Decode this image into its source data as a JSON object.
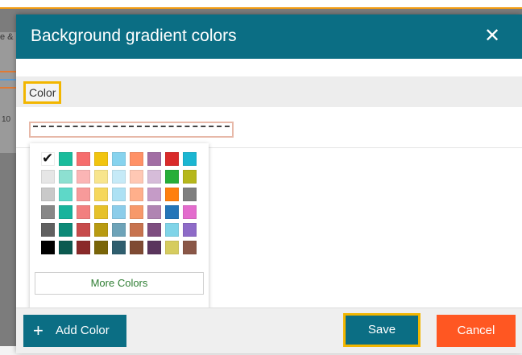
{
  "background": {
    "snippet_top": "e &",
    "snippet_bottom": "10"
  },
  "modal": {
    "title": "Background gradient colors",
    "close_icon": "close-icon",
    "section_label": "Color",
    "color_input_value": "",
    "palette": {
      "selected_color": "#ffffff",
      "rows": [
        [
          "#ffffff",
          "#1abc9c",
          "#f66d6d",
          "#f1c40f",
          "#87d3ee",
          "#ff9166",
          "#a26ea4",
          "#d92a2a",
          "#1bb6d2"
        ],
        [
          "#e6e6e6",
          "#8de0d1",
          "#fbb5b5",
          "#f8e58d",
          "#c6eaf7",
          "#ffc8b4",
          "#d6bcd9",
          "#27ae38",
          "#b6b71b"
        ],
        [
          "#c9c9c9",
          "#5ed8c8",
          "#f79a9a",
          "#f6d75c",
          "#ade1f4",
          "#ffaf8b",
          "#c59bc7",
          "#ff7f0e",
          "#7f7f7f"
        ],
        [
          "#878787",
          "#19b39c",
          "#f27f7f",
          "#e6c12a",
          "#8ccdea",
          "#f7996b",
          "#b084b2",
          "#2475b8",
          "#e36ccd"
        ],
        [
          "#606060",
          "#0e8a78",
          "#c74b4b",
          "#b89a11",
          "#6ea3b8",
          "#c7734f",
          "#7e4e80",
          "#80d4e8",
          "#8e6bc8"
        ],
        [
          "#000000",
          "#0b5a50",
          "#8a2a2a",
          "#7a6508",
          "#2f5e6e",
          "#7f4a33",
          "#5a355d",
          "#d6cc5f",
          "#8a5747"
        ]
      ],
      "more_colors_label": "More Colors"
    },
    "footer": {
      "add_color_label": "Add Color",
      "save_label": "Save",
      "cancel_label": "Cancel"
    }
  }
}
